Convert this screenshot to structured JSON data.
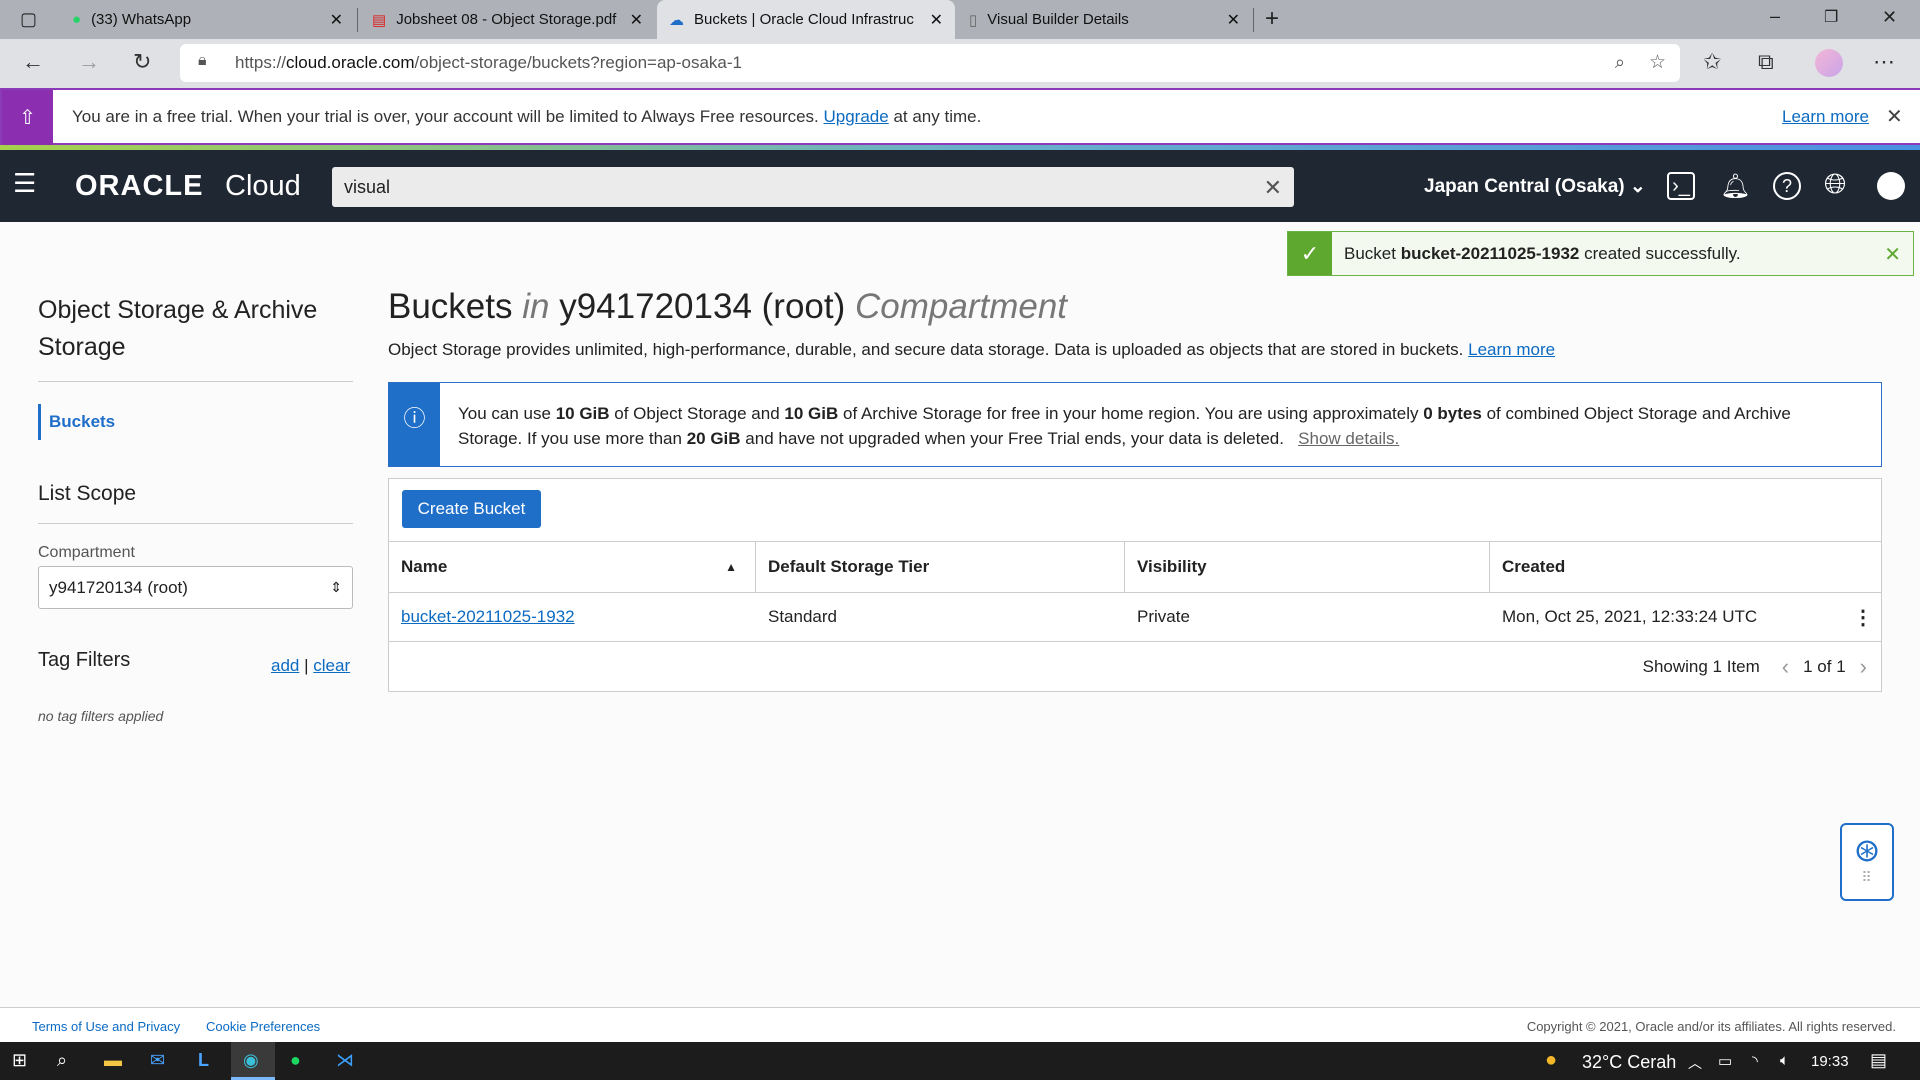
{
  "browser": {
    "tabs": [
      {
        "label": "(33) WhatsApp",
        "icon": "whatsapp-icon"
      },
      {
        "label": "Jobsheet 08 - Object Storage.pdf",
        "icon": "pdf-icon"
      },
      {
        "label": "Buckets | Oracle Cloud Infrastruc",
        "icon": "cloud-icon",
        "active": true
      },
      {
        "label": "Visual Builder Details",
        "icon": "page-icon"
      }
    ],
    "url_prefix": "https://",
    "url_domain": "cloud.oracle.com",
    "url_path": "/object-storage/buckets?region=ap-osaka-1"
  },
  "trial": {
    "text": "You are in a free trial. When your trial is over, your account will be limited to Always Free resources.",
    "upgrade": "Upgrade",
    "suffix": "at any time.",
    "learn_more": "Learn more"
  },
  "header": {
    "logo": "ORACLE",
    "logo_cloud": "Cloud",
    "search_value": "visual",
    "region": "Japan Central (Osaka)"
  },
  "toast": {
    "prefix": "Bucket",
    "bucket": "bucket-20211025-1932",
    "suffix": "created successfully."
  },
  "sidebar": {
    "title": "Object Storage & Archive Storage",
    "items": [
      {
        "label": "Buckets",
        "active": true
      }
    ],
    "list_scope": "List Scope",
    "compartment_label": "Compartment",
    "compartment_value": "y941720134 (root)",
    "tag_filters": "Tag Filters",
    "add": "add",
    "sep": "|",
    "clear": "clear",
    "no_filters": "no tag filters applied"
  },
  "main": {
    "title": "Buckets",
    "title_in": "in",
    "title_comp": "y941720134 (root)",
    "title_suffix": "Compartment",
    "description": "Object Storage provides unlimited, high-performance, durable, and secure data storage. Data is uploaded as objects that are stored in buckets.",
    "learn_more": "Learn more",
    "info": {
      "t1": "You can use",
      "v1": "10 GiB",
      "t2": "of Object Storage and",
      "v2": "10 GiB",
      "t3": "of Archive Storage for free in your home region. You are using approximately",
      "v3": "0 bytes",
      "t4": "of combined Object Storage and Archive Storage. If you use more than",
      "v4": "20 GiB",
      "t5": "and have not upgraded when your Free Trial ends, your data is deleted.",
      "show": "Show details."
    },
    "create_bucket": "Create Bucket",
    "columns": [
      "Name",
      "Default Storage Tier",
      "Visibility",
      "Created"
    ],
    "rows": [
      {
        "name": "bucket-20211025-1932",
        "tier": "Standard",
        "visibility": "Private",
        "created": "Mon, Oct 25, 2021, 12:33:24 UTC"
      }
    ],
    "showing": "Showing 1 Item",
    "page": "1 of 1"
  },
  "footer": {
    "terms": "Terms of Use and Privacy",
    "cookies": "Cookie Preferences",
    "copyright": "Copyright © 2021, Oracle and/or its affiliates. All rights reserved."
  },
  "taskbar": {
    "weather": "32°C  Cerah",
    "time": "19:33"
  },
  "colors": {
    "accent": "#1f6fc9",
    "header": "#1f2733",
    "trial": "#8b2fb0",
    "success": "#5fa82f"
  }
}
